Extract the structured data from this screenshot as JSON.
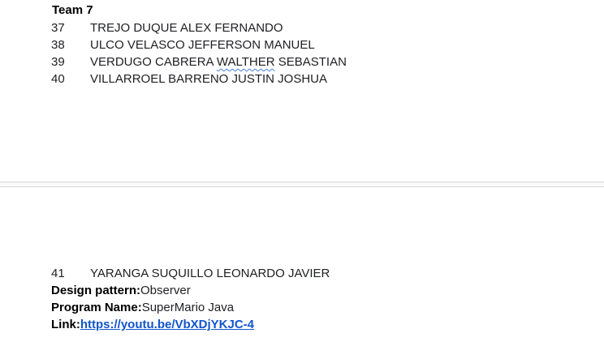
{
  "team": {
    "title": "Team 7"
  },
  "members": [
    {
      "number": "37",
      "name": "TREJO DUQUE ALEX FERNANDO"
    },
    {
      "number": "38",
      "name": "ULCO VELASCO JEFFERSON MANUEL"
    },
    {
      "number": "39",
      "name_pre": "VERDUGO CABRERA ",
      "name_flagged": "WALTHER",
      "name_post": " SEBASTIAN"
    },
    {
      "number": "40",
      "name": "VILLARROEL BARRENO JUSTIN JOSHUA"
    },
    {
      "number": "41",
      "name": "YARANGA SUQUILLO LEONARDO JAVIER"
    }
  ],
  "project": {
    "design_pattern_label": "Design pattern:",
    "design_pattern_value": "Observer",
    "program_name_label": "Program Name:",
    "program_name_value": "SuperMario Java",
    "link_label": "Link:",
    "link_value": "https://youtu.be/VbXDjYKJC-4"
  }
}
